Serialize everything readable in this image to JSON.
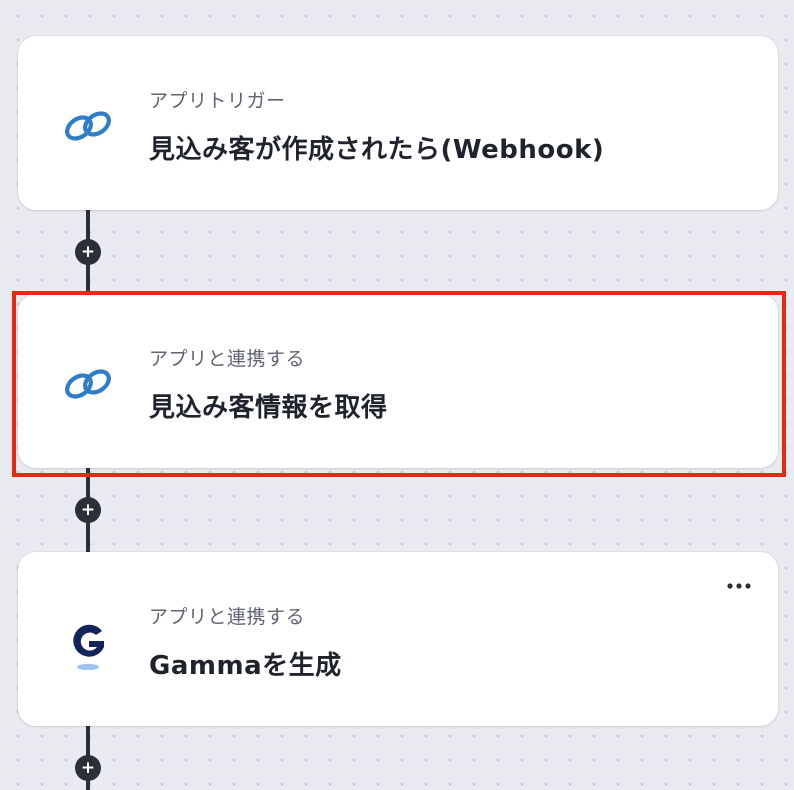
{
  "steps": [
    {
      "app_label": "アプリトリガー",
      "title": "見込み客が作成されたら(Webhook)",
      "icon": "zoho-crm-icon"
    },
    {
      "app_label": "アプリと連携する",
      "title": "見込み客情報を取得",
      "icon": "zoho-crm-icon"
    },
    {
      "app_label": "アプリと連携する",
      "title": "Gammaを生成",
      "icon": "gamma-icon"
    }
  ],
  "add_symbol": "+",
  "colors": {
    "background": "#e9ebf0",
    "connector": "#2b2f36",
    "highlight": "#e52a12",
    "zoho_blue": "#2f7dc6",
    "gamma_navy": "#12245a",
    "gamma_light": "#9ec4f3"
  }
}
